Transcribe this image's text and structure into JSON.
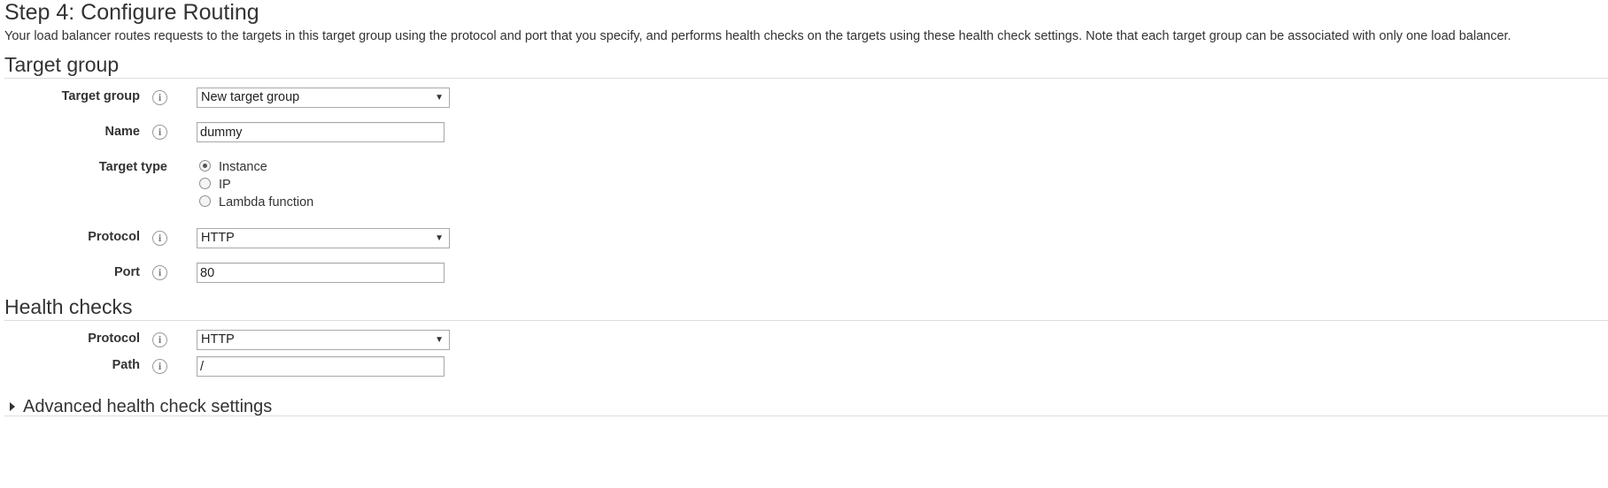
{
  "page": {
    "title": "Step 4: Configure Routing",
    "description": "Your load balancer routes requests to the targets in this target group using the protocol and port that you specify, and performs health checks on the targets using these health check settings. Note that each target group can be associated with only one load balancer."
  },
  "target_group_section": {
    "heading": "Target group",
    "target_group": {
      "label": "Target group",
      "value": "New target group"
    },
    "name": {
      "label": "Name",
      "value": "dummy"
    },
    "target_type": {
      "label": "Target type",
      "options": [
        "Instance",
        "IP",
        "Lambda function"
      ],
      "selected": "Instance"
    },
    "protocol": {
      "label": "Protocol",
      "value": "HTTP"
    },
    "port": {
      "label": "Port",
      "value": "80"
    }
  },
  "health_checks_section": {
    "heading": "Health checks",
    "protocol": {
      "label": "Protocol",
      "value": "HTTP"
    },
    "path": {
      "label": "Path",
      "value": "/"
    }
  },
  "advanced": {
    "label": "Advanced health check settings"
  },
  "icons": {
    "info": "info-icon",
    "dropdown": "dropdown-arrow-icon",
    "expand": "caret-right-icon"
  }
}
